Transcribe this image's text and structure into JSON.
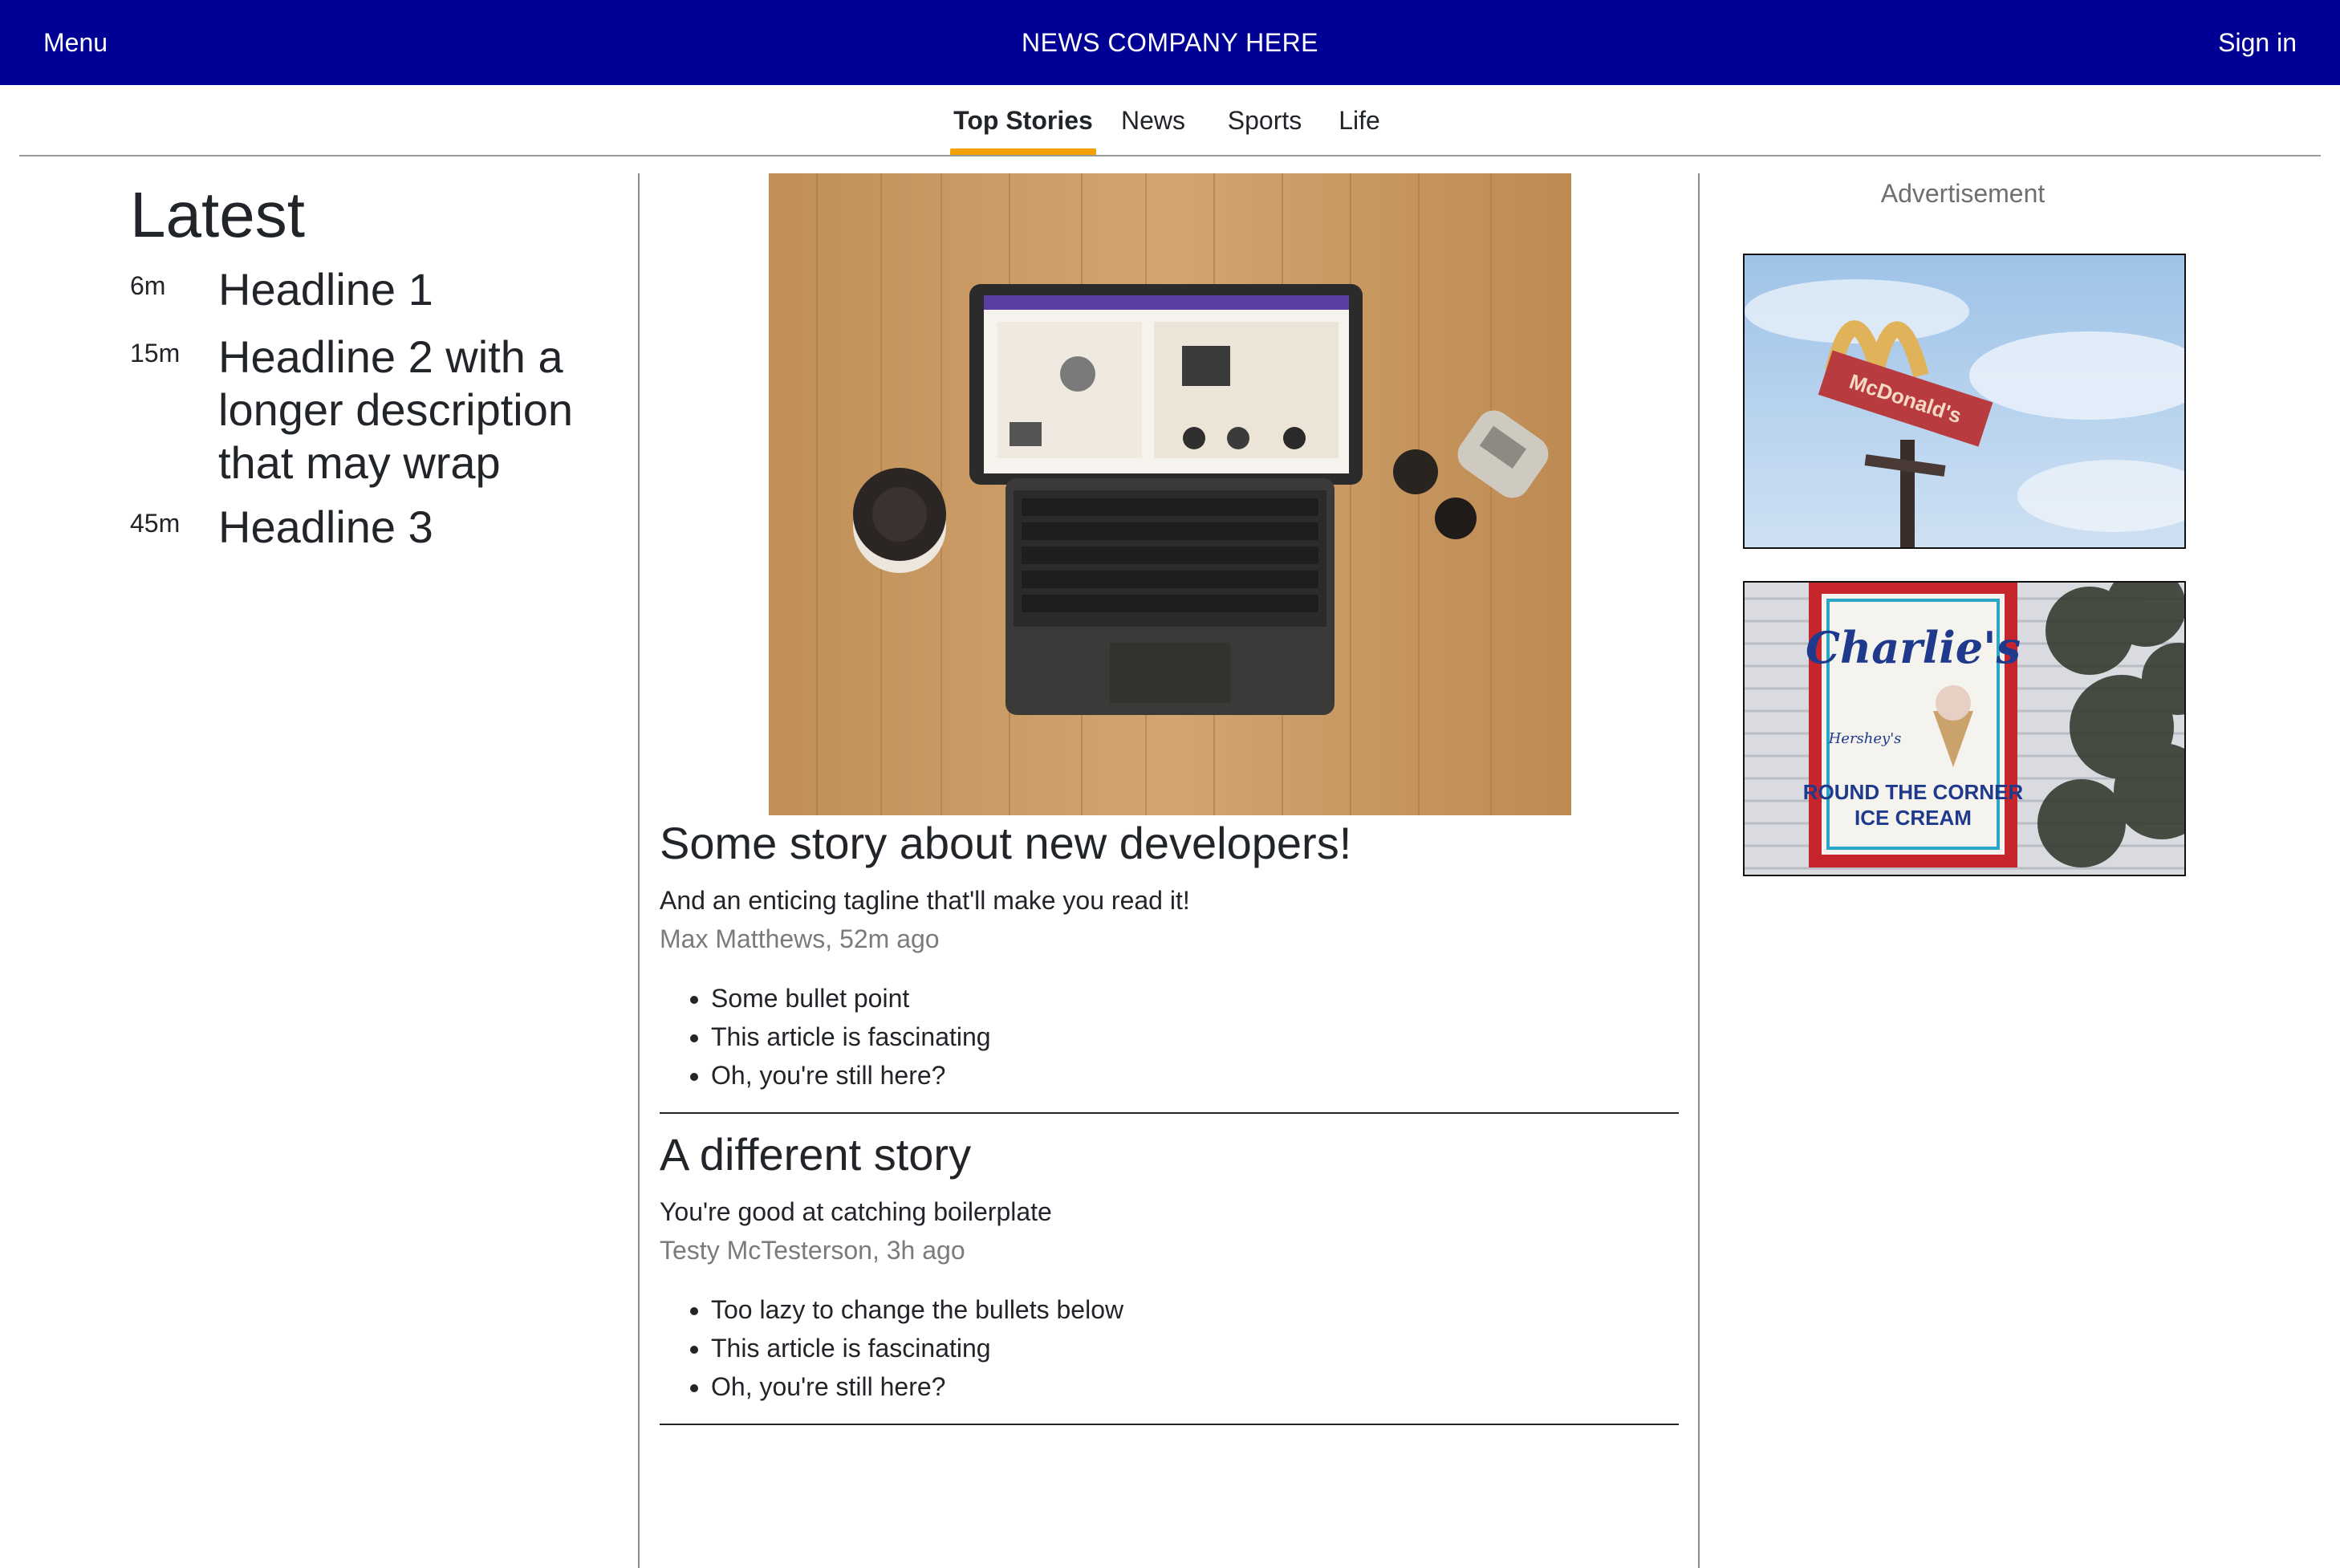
{
  "header": {
    "menu_label": "Menu",
    "brand": "NEWS COMPANY HERE",
    "signin_label": "Sign in",
    "bg_color": "#000094"
  },
  "tabs": [
    {
      "label": "Top Stories",
      "active": true
    },
    {
      "label": "News",
      "active": false
    },
    {
      "label": "Sports",
      "active": false
    },
    {
      "label": "Life",
      "active": false
    }
  ],
  "accent_color": "#f4a000",
  "latest": {
    "title": "Latest",
    "items": [
      {
        "time": "6m",
        "headline": "Headline 1"
      },
      {
        "time": "15m",
        "headline": "Headline 2 with a longer description that may wrap"
      },
      {
        "time": "45m",
        "headline": "Headline 3"
      }
    ]
  },
  "stories": [
    {
      "title": "Some story about new developers!",
      "tagline": "And an enticing tagline that'll make you read it!",
      "meta": "Max Matthews, 52m ago",
      "bullets": [
        "Some bullet point",
        "This article is fascinating",
        "Oh, you're still here?"
      ]
    },
    {
      "title": "A different story",
      "tagline": "You're good at catching boilerplate",
      "meta": "Testy McTesterson, 3h ago",
      "bullets": [
        "Too lazy to change the bullets below",
        "This article is fascinating",
        "Oh, you're still here?"
      ]
    }
  ],
  "ads": {
    "label": "Advertisement",
    "images": [
      {
        "sign_text": "McDonald's"
      },
      {
        "sign_text": "Charlie's",
        "sign_subtext": "ROUND THE CORNER",
        "sign_subtext2": "ICE CREAM",
        "sign_script": "Hershey's"
      }
    ]
  }
}
